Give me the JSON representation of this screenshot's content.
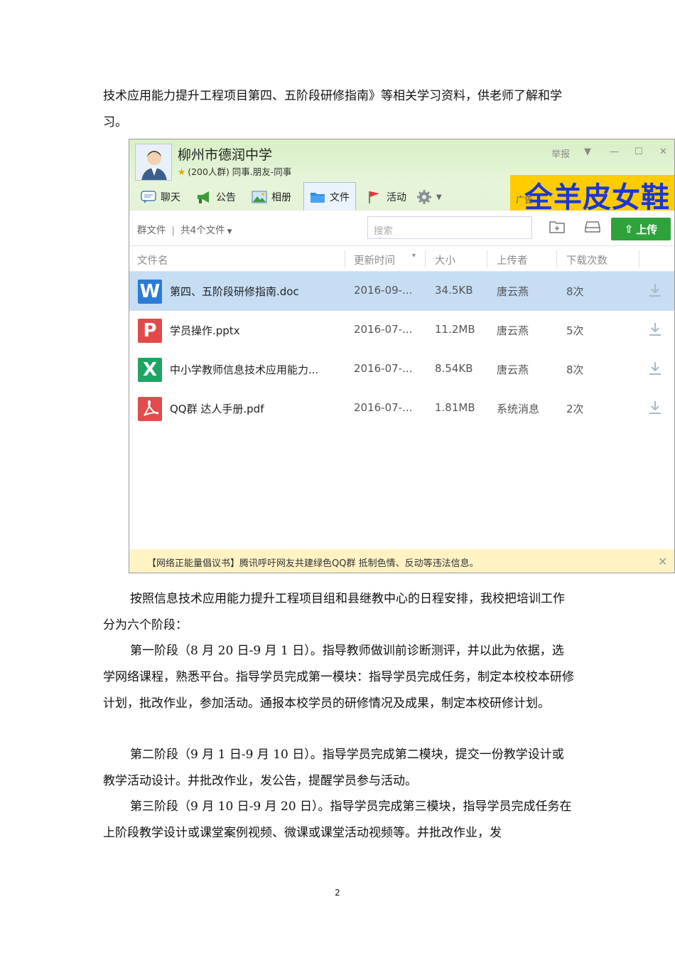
{
  "doc": {
    "para_top": "技术应用能力提升工程项目第四、五阶段研修指南》等相关学习资料，供老师了解和学习。",
    "para_1": "按照信息技术应用能力提升工程项目组和县继教中心的日程安排，我校把培训工作分为六个阶段：",
    "para_2": "第一阶段（8 月 20 日-9 月 1 日）。指导教师做训前诊断测评，并以此为依据，选学网络课程，熟悉平台。指导学员完成第一模块：指导学员完成任务，制定本校校本研修计划，批改作业，参加活动。通报本校学员的研修情况及成果，制定本校研修计划。",
    "para_3": "第二阶段（9 月 1 日-9 月 10 日）。指导学员完成第二模块，提交一份教学设计或教学活动设计。并批改作业，发公告，提醒学员参与活动。",
    "para_4": "第三阶段（9 月 10 日-9 月 20 日）。指导学员完成第三模块，指导学员完成任务在上阶段教学设计或课堂案例视频、微课或课堂活动视频等。并批改作业，发",
    "page_number": "2"
  },
  "qq": {
    "group_name": "柳州市德润中学",
    "group_sub": "(200人群) 同事.朋友-同事",
    "report": "举报",
    "toolbar": [
      "聊天",
      "公告",
      "相册",
      "文件",
      "活动"
    ],
    "ad_label": "广告",
    "ad_text": "全羊皮女鞋",
    "crumb_group": "群文件",
    "crumb_count": "共4个文件",
    "search_placeholder": "搜索",
    "upload": "上传",
    "columns": [
      "文件名",
      "更新时间",
      "大小",
      "上传者",
      "下载次数"
    ],
    "files": [
      {
        "type": "W",
        "name": "第四、五阶段研修指南.doc",
        "time": "2016-09-...",
        "size": "34.5KB",
        "uploader": "唐云燕",
        "downloads": "8次"
      },
      {
        "type": "P",
        "name": "学员操作.pptx",
        "time": "2016-07-...",
        "size": "11.2MB",
        "uploader": "唐云燕",
        "downloads": "5次"
      },
      {
        "type": "X",
        "name": "中小学教师信息技术应用能力...",
        "time": "2016-07-...",
        "size": "8.54KB",
        "uploader": "唐云燕",
        "downloads": "8次"
      },
      {
        "type": "PDF",
        "name": "QQ群 达人手册.pdf",
        "time": "2016-07-...",
        "size": "1.81MB",
        "uploader": "系统消息",
        "downloads": "2次"
      }
    ],
    "notice": "【网络正能量倡议书】腾讯呼吁网友共建绿色QQ群 抵制色情、反动等违法信息。",
    "colors": {
      "doc": "#2b7cd3",
      "ppt": "#e14a4a",
      "xls": "#1fa463",
      "pdf": "#e24c4c",
      "upload": "#2fa33b",
      "selected_row": "#c6ddf4"
    }
  }
}
